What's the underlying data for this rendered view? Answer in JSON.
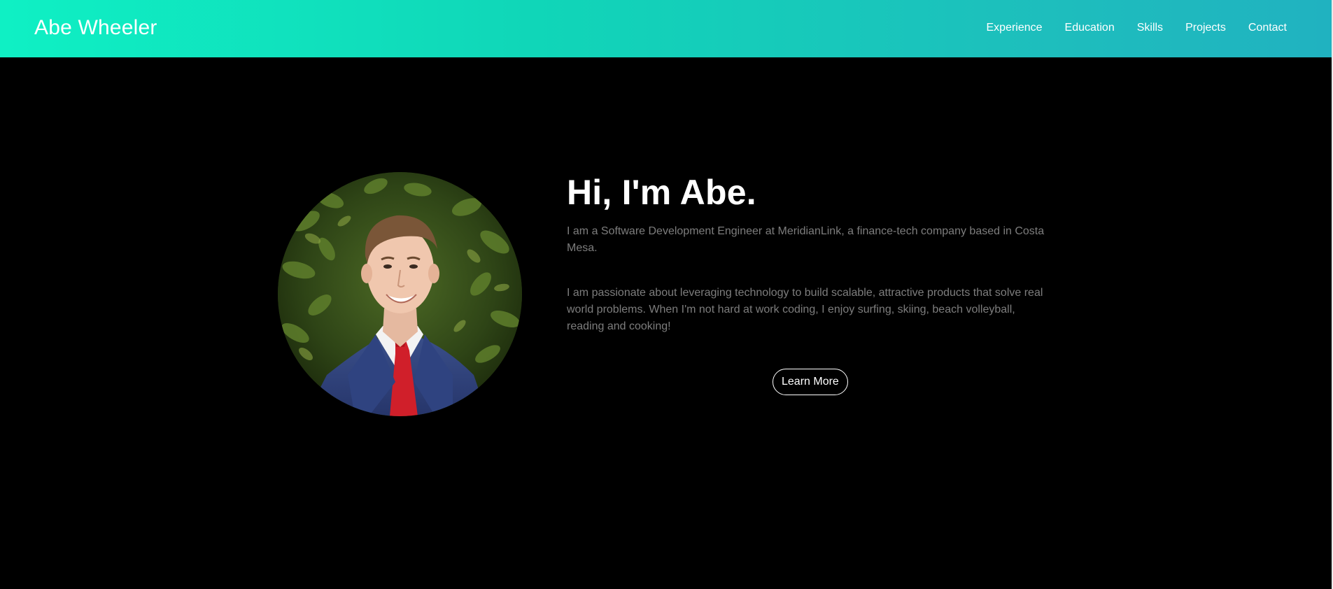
{
  "navbar": {
    "brand": "Abe Wheeler",
    "links": [
      {
        "label": "Experience"
      },
      {
        "label": "Education"
      },
      {
        "label": "Skills"
      },
      {
        "label": "Projects"
      },
      {
        "label": "Contact"
      }
    ]
  },
  "hero": {
    "headline": "Hi, I'm Abe.",
    "paragraphs": [
      "I am a Software Development Engineer at MeridianLink, a finance-tech company based in Costa Mesa.",
      "I am passionate about leveraging technology to build scalable, attractive products that solve real world problems. When I'm not hard at work coding, I enjoy surfing, skiing, beach volleyball, reading and cooking!"
    ],
    "cta_label": "Learn More"
  },
  "colors": {
    "nav_gradient_start": "#0ff0c4",
    "nav_gradient_end": "#20b2c0",
    "background": "#000000",
    "body_text": "#7d7d7d",
    "heading_text": "#ffffff"
  }
}
